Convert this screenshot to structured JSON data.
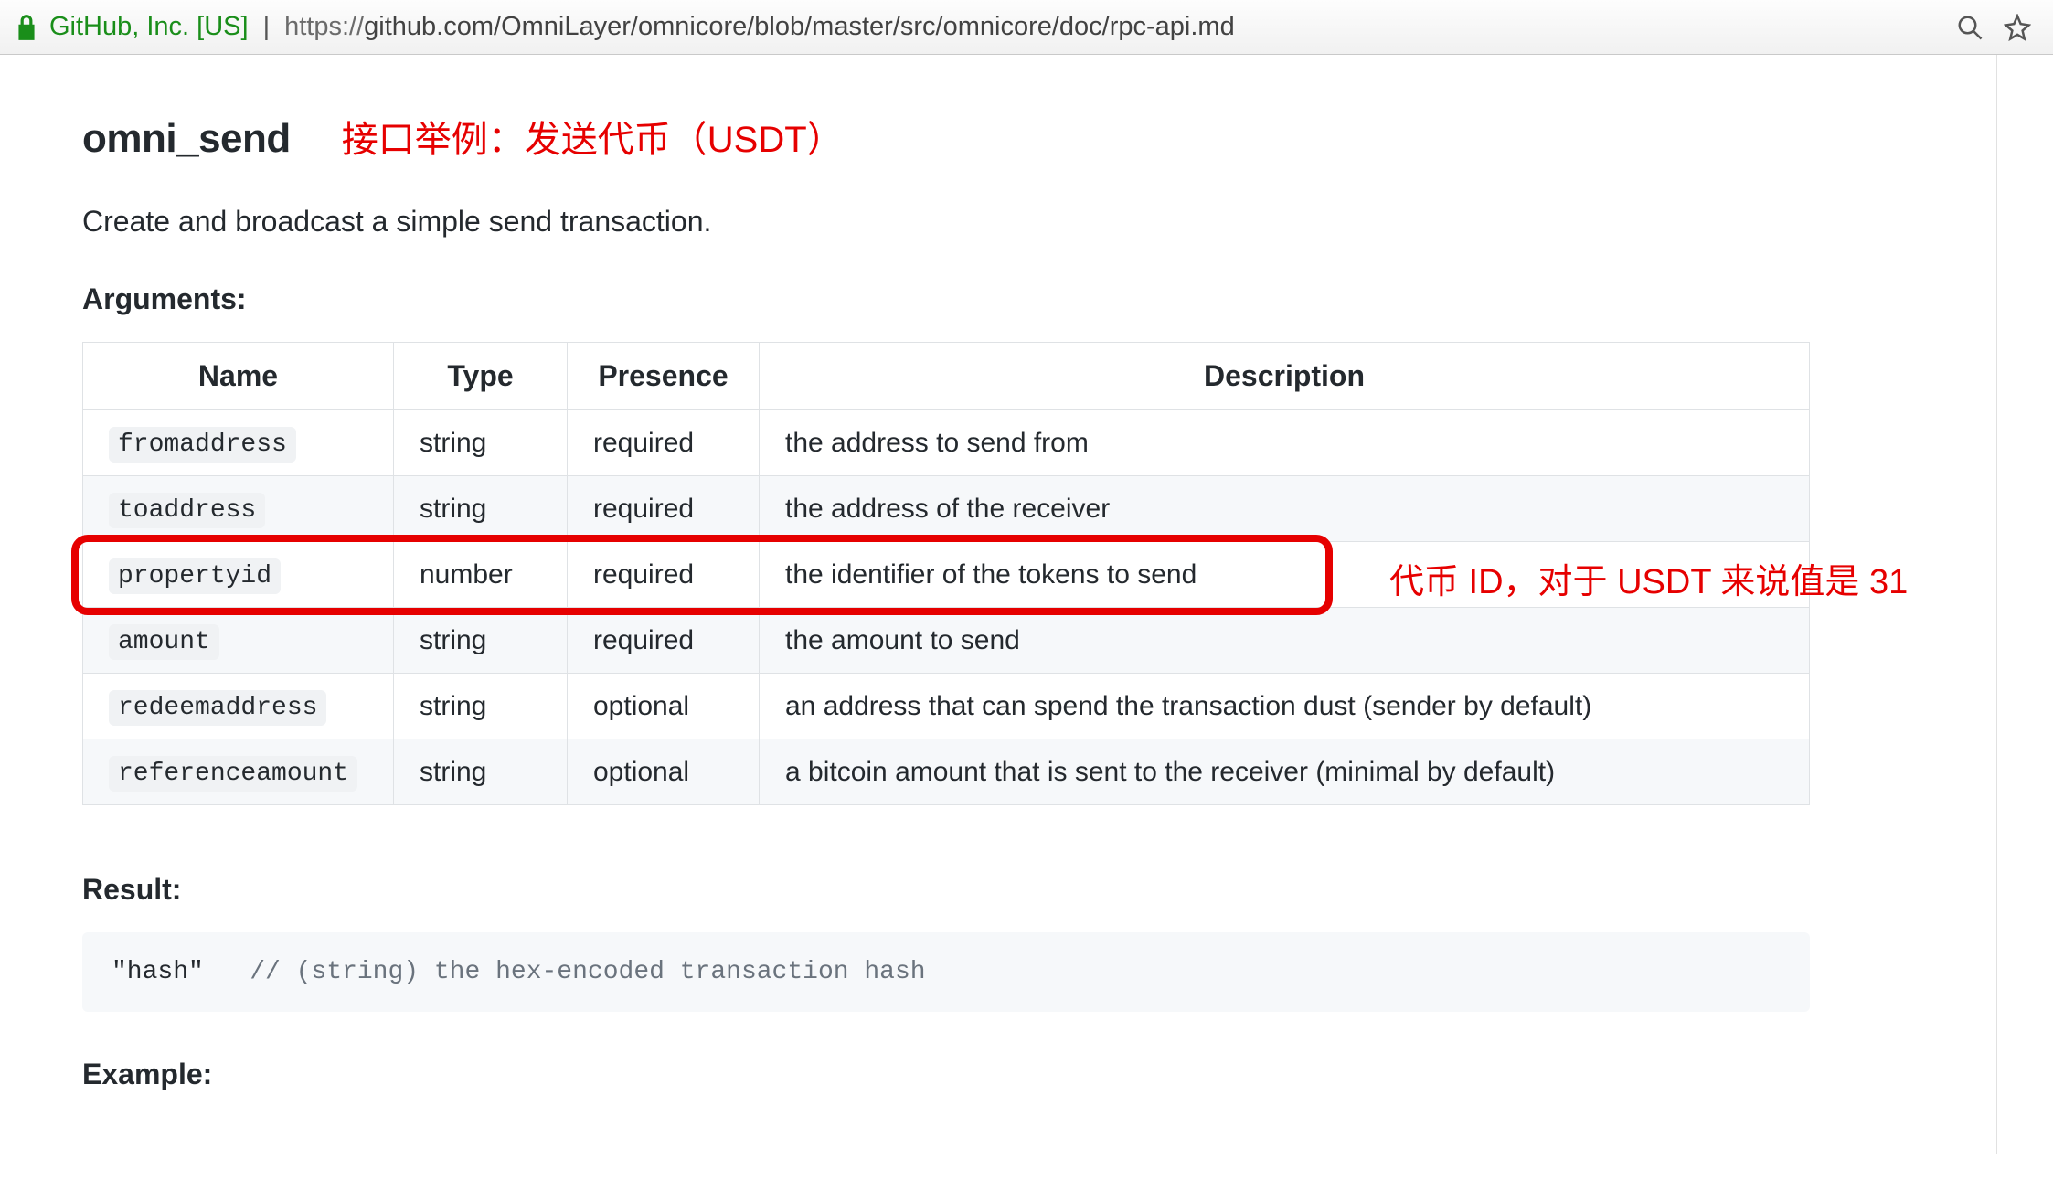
{
  "browser": {
    "secure_org": "GitHub, Inc. [US]",
    "url_scheme": "https://",
    "url_rest": "github.com/OmniLayer/omnicore/blob/master/src/omnicore/doc/rpc-api.md"
  },
  "doc": {
    "api_name": "omni_send",
    "annotation_heading": "接口举例：发送代币（USDT）",
    "lead": "Create and broadcast a simple send transaction.",
    "arguments_heading": "Arguments:",
    "columns": {
      "name": "Name",
      "type": "Type",
      "presence": "Presence",
      "description": "Description"
    },
    "rows": [
      {
        "name": "fromaddress",
        "type": "string",
        "presence": "required",
        "description": "the address to send from"
      },
      {
        "name": "toaddress",
        "type": "string",
        "presence": "required",
        "description": "the address of the receiver"
      },
      {
        "name": "propertyid",
        "type": "number",
        "presence": "required",
        "description": "the identifier of the tokens to send"
      },
      {
        "name": "amount",
        "type": "string",
        "presence": "required",
        "description": "the amount to send"
      },
      {
        "name": "redeemaddress",
        "type": "string",
        "presence": "optional",
        "description": "an address that can spend the transaction dust (sender by default)"
      },
      {
        "name": "referenceamount",
        "type": "string",
        "presence": "optional",
        "description": "a bitcoin amount that is sent to the receiver (minimal by default)"
      }
    ],
    "highlight_row_index": 2,
    "annotation_row": "代币 ID，对于 USDT 来说值是 31",
    "result_heading": "Result:",
    "result_code": {
      "string_token": "\"hash\"",
      "comment_token": "// (string) the hex-encoded transaction hash"
    },
    "example_heading": "Example:"
  }
}
